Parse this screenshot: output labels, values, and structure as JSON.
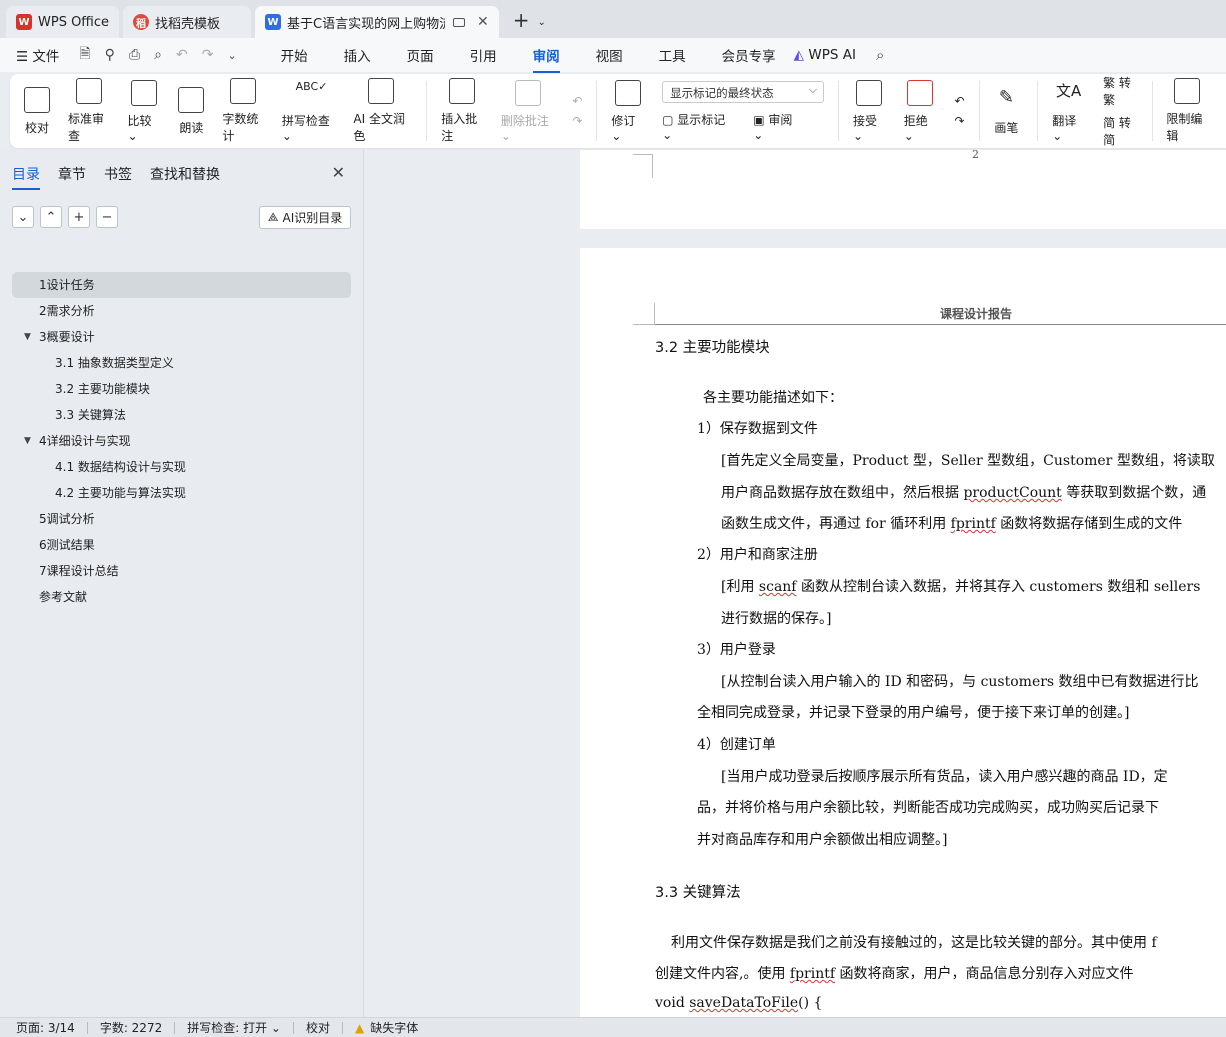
{
  "tabs": [
    {
      "label": "WPS Office",
      "icon": "wps-logo-icon"
    },
    {
      "label": "找稻壳模板",
      "icon": "docer-icon"
    },
    {
      "label": "基于C语言实现的网上购物流和",
      "icon": "writer-doc-icon"
    }
  ],
  "menu": {
    "file_label": "文件",
    "items": [
      "开始",
      "插入",
      "页面",
      "引用",
      "审阅",
      "视图",
      "工具",
      "会员专享"
    ],
    "active": "审阅",
    "wps_ai": "WPS AI"
  },
  "ribbon": {
    "proofread": "校对",
    "standard_review": "标准审查",
    "compare": "比较",
    "read_aloud": "朗读",
    "word_count": "字数统计",
    "spell_check": "拼写检查",
    "ai_polish": "AI 全文润色",
    "insert_comment": "插入批注",
    "delete_comment": "删除批注",
    "track_changes": "修订",
    "markup_view": "显示标记的最终状态",
    "show_markup": "显示标记",
    "review_pane": "审阅",
    "accept": "接受",
    "reject": "拒绝",
    "pen": "画笔",
    "translate": "翻译",
    "to_traditional": "转繁",
    "to_simplified": "转简",
    "restrict_edit": "限制编辑"
  },
  "panel": {
    "tabs": [
      "目录",
      "章节",
      "书签",
      "查找和替换"
    ],
    "active_tab": "目录",
    "ai_toc": "AI识别目录",
    "toc": [
      {
        "text": "1设计任务",
        "level": 1,
        "selected": true
      },
      {
        "text": "2需求分析",
        "level": 1
      },
      {
        "text": "3概要设计",
        "level": 1,
        "expanded": true
      },
      {
        "text": "3.1 抽象数据类型定义",
        "level": 2
      },
      {
        "text": "3.2  主要功能模块",
        "level": 2
      },
      {
        "text": "3.3  关键算法",
        "level": 2
      },
      {
        "text": "4详细设计与实现",
        "level": 1,
        "expanded": true
      },
      {
        "text": "4.1  数据结构设计与实现",
        "level": 2
      },
      {
        "text": "4.2  主要功能与算法实现",
        "level": 2
      },
      {
        "text": "5调试分析",
        "level": 1
      },
      {
        "text": "6测试结果",
        "level": 1
      },
      {
        "text": "7课程设计总结",
        "level": 1
      },
      {
        "text": "参考文献",
        "level": 1
      }
    ]
  },
  "document": {
    "prev_page_number": "2",
    "header": "课程设计报告",
    "h32": "3.2  主要功能模块",
    "intro": "各主要功能描述如下：",
    "f1_title": "1）保存数据到文件",
    "f1_l1": "[首先定义全局变量，Product 型，Seller 型数组，Customer 型数组，将读取",
    "f1_l2a": "用户商品数据存放在数组中，然后根据 ",
    "f1_l2b": "productCount",
    "f1_l2c": " 等获取到数据个数，通",
    "f1_l3a": "函数生成文件，再通过 for 循环利用 ",
    "f1_l3b": "fprintf",
    "f1_l3c": " 函数将数据存储到生成的文件",
    "f2_title": "2）用户和商家注册",
    "f2_l1a": "[利用 ",
    "f2_l1b": "scanf",
    "f2_l1c": " 函数从控制台读入数据，并将其存入 customers 数组和 sellers",
    "f2_l2": "进行数据的保存。]",
    "f3_title": "3）用户登录",
    "f3_l1": "[从控制台读入用户输入的 ID 和密码，与 customers 数组中已有数据进行比",
    "f3_l2": "全相同完成登录，并记录下登录的用户编号，便于接下来订单的创建。]",
    "f4_title": "4）创建订单",
    "f4_l1": "[当用户成功登录后按顺序展示所有货品，读入用户感兴趣的商品 ID，定",
    "f4_l2": "品，并将价格与用户余额比较，判断能否成功完成购买，成功购买后记录下",
    "f4_l3": "并对商品库存和用户余额做出相应调整。]",
    "h33": "3.3  关键算法",
    "p33_l1": "利用文件保存数据是我们之前没有接触过的，这是比较关键的部分。其中使用 f",
    "p33_l2a": "创建文件内容,。使用 ",
    "p33_l2b": "fprintf",
    "p33_l2c": " 函数将商家，用户，商品信息分别存入对应文件",
    "code1a": "void ",
    "code1b": "saveDataToFile",
    "code1c": "() {"
  },
  "status": {
    "page": "页面: 3/14",
    "words": "字数: 2272",
    "spell": "拼写检查: 打开",
    "proof": "校对",
    "missing_font": "缺失字体"
  },
  "colors": {
    "accent": "#1a5fd0",
    "wps_red": "#d9322b",
    "writer_blue": "#2f6de1"
  }
}
